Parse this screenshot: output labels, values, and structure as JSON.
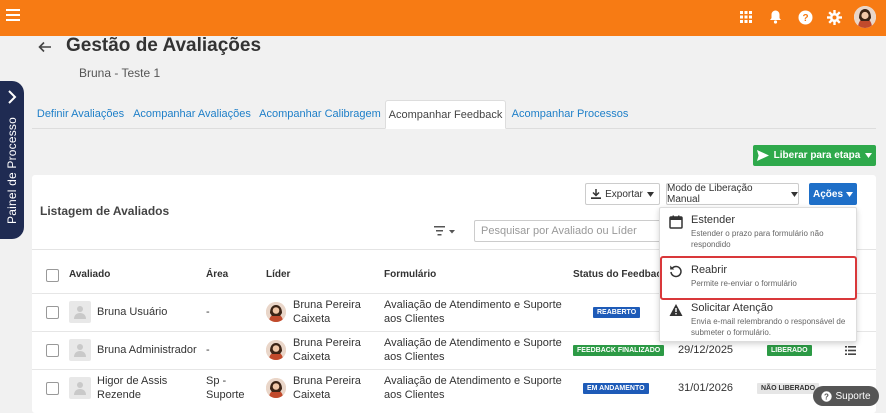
{
  "header": {
    "menu_icon": "hamburger-icon",
    "icons": [
      "grid-icon",
      "bell-icon",
      "help-icon",
      "gear-icon"
    ]
  },
  "side_panel": {
    "label": "Painel de Processo"
  },
  "page": {
    "title": "Gestão de Avaliações",
    "subtitle": "Bruna - Teste 1"
  },
  "tabs": [
    {
      "label": "Definir Avaliações"
    },
    {
      "label": "Acompanhar Avaliações"
    },
    {
      "label": "Acompanhar Calibragem"
    },
    {
      "label": "Acompanhar Feedback"
    },
    {
      "label": "Acompanhar Processos"
    }
  ],
  "actions": {
    "liberar": "Liberar para etapa",
    "exportar": "Exportar",
    "modo": "Modo de Liberação Manual",
    "acoes": "Ações"
  },
  "list": {
    "title": "Listagem de Avaliados",
    "search_placeholder": "Pesquisar por Avaliado ou Líder"
  },
  "table": {
    "headers": {
      "avaliado": "Avaliado",
      "area": "Área",
      "lider": "Líder",
      "formulario": "Formulário",
      "status": "Status do Feedback"
    },
    "rows": [
      {
        "avaliado": "Bruna Usuário",
        "area": "-",
        "lider": "Bruna Pereira Caixeta",
        "formulario": "Avaliação de Atendimento e Suporte aos Clientes",
        "status": "REABERTO",
        "data": "",
        "liberacao": ""
      },
      {
        "avaliado": "Bruna Administrador",
        "area": "-",
        "lider": "Bruna Pereira Caixeta",
        "formulario": "Avaliação de Atendimento e Suporte aos Clientes",
        "status": "FEEDBACK FINALIZADO",
        "data": "29/12/2025",
        "liberacao": "LIBERADO"
      },
      {
        "avaliado": "Higor de Assis Rezende",
        "area": "Sp - Suporte",
        "lider": "Bruna Pereira Caixeta",
        "formulario": "Avaliação de Atendimento e Suporte aos Clientes",
        "status": "EM ANDAMENTO",
        "data": "31/01/2026",
        "liberacao": "NÃO LIBERADO"
      }
    ]
  },
  "dropdown": {
    "items": [
      {
        "title": "Estender",
        "desc": "Estender o prazo para formulário não respondido",
        "icon": "calendar-icon"
      },
      {
        "title": "Reabrir",
        "desc": "Permite re-enviar o formulário",
        "icon": "reopen-icon"
      },
      {
        "title": "Solicitar Atenção",
        "desc": "Envia e-mail relembrando o responsável de submeter o formulário.",
        "icon": "warning-icon"
      }
    ]
  },
  "support": {
    "label": "Suporte"
  },
  "colors": {
    "topbar": "#f77b14",
    "side_panel": "#1f2b52",
    "primary": "#1e6fc8",
    "success": "#2ea94b",
    "reaberto": "#1e5bb8",
    "finalizado": "#2c9a45",
    "andamento": "#1e5bb8",
    "highlight": "#d9383a"
  }
}
